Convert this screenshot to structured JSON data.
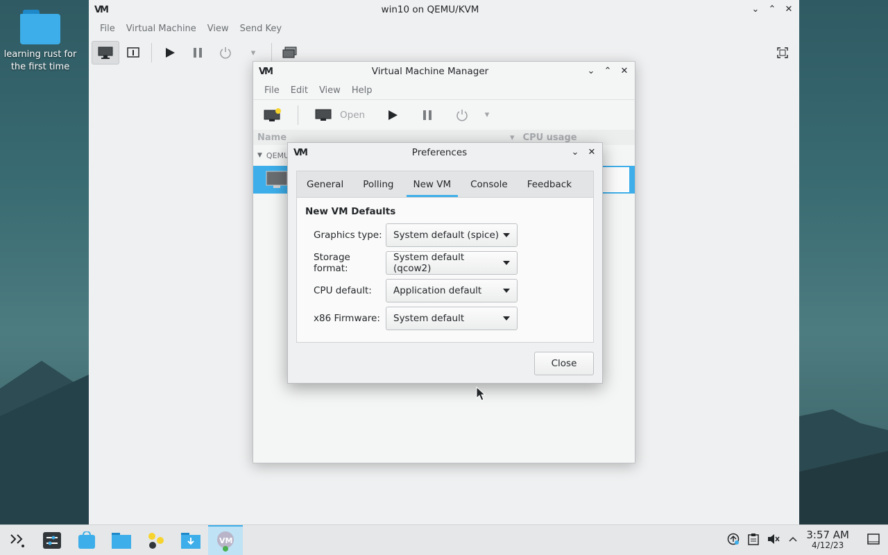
{
  "desktop": {
    "icon_label": "learning rust for the first time"
  },
  "main_window": {
    "title": "win10 on QEMU/KVM",
    "menu": [
      "File",
      "Virtual Machine",
      "View",
      "Send Key"
    ]
  },
  "vmm_window": {
    "title": "Virtual Machine Manager",
    "menu": [
      "File",
      "Edit",
      "View",
      "Help"
    ],
    "toolbar": {
      "open_label": "Open"
    },
    "list": {
      "col_name": "Name",
      "col_cpu": "CPU usage",
      "group": "QEMU"
    }
  },
  "pref_dialog": {
    "title": "Preferences",
    "tabs": [
      "General",
      "Polling",
      "New VM",
      "Console",
      "Feedback"
    ],
    "active_tab": "New VM",
    "section_title": "New VM Defaults",
    "fields": [
      {
        "label": "Graphics type:",
        "value": "System default (spice)"
      },
      {
        "label": "Storage format:",
        "value": "System default (qcow2)"
      },
      {
        "label": "CPU default:",
        "value": "Application default"
      },
      {
        "label": "x86 Firmware:",
        "value": "System default"
      }
    ],
    "close_label": "Close"
  },
  "taskbar": {
    "clock_time": "3:57 AM",
    "clock_date": "4/12/23"
  },
  "colors": {
    "accent": "#3daee9"
  }
}
